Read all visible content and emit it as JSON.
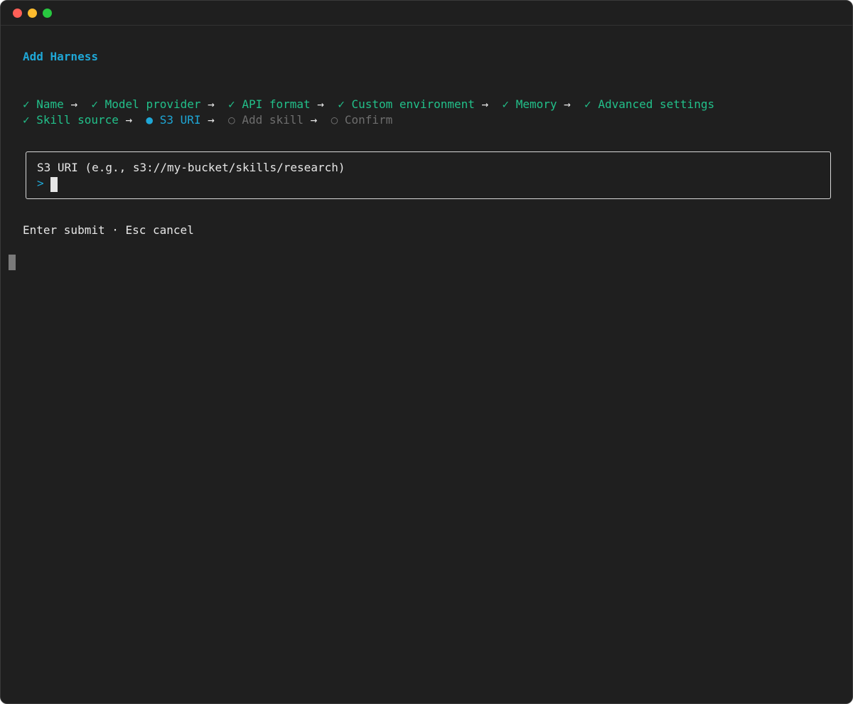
{
  "window": {
    "controls": [
      "close",
      "minimize",
      "maximize"
    ]
  },
  "header": {
    "title": "Add Harness"
  },
  "steps": {
    "check_symbol": "✓",
    "active_symbol": "●",
    "pending_symbol": "○",
    "arrow": "→",
    "items": [
      {
        "label": "Name",
        "state": "done"
      },
      {
        "label": "Model provider",
        "state": "done"
      },
      {
        "label": "API format",
        "state": "done"
      },
      {
        "label": "Custom environment",
        "state": "done"
      },
      {
        "label": "Memory",
        "state": "done"
      },
      {
        "label": "Advanced settings",
        "state": "done"
      },
      {
        "label": "Skill source",
        "state": "done"
      },
      {
        "label": "S3 URI",
        "state": "active"
      },
      {
        "label": "Add skill",
        "state": "pending"
      },
      {
        "label": "Confirm",
        "state": "pending"
      }
    ]
  },
  "input": {
    "label": "S3 URI (e.g., s3://my-bucket/skills/research)",
    "prompt": ">",
    "value": ""
  },
  "footer": {
    "hint": "Enter submit · Esc cancel"
  },
  "colors": {
    "background": "#1f1f1f",
    "accent": "#1fa7d6",
    "done": "#22c08a",
    "pending": "#6e6e6e",
    "text": "#e6e6e6"
  }
}
